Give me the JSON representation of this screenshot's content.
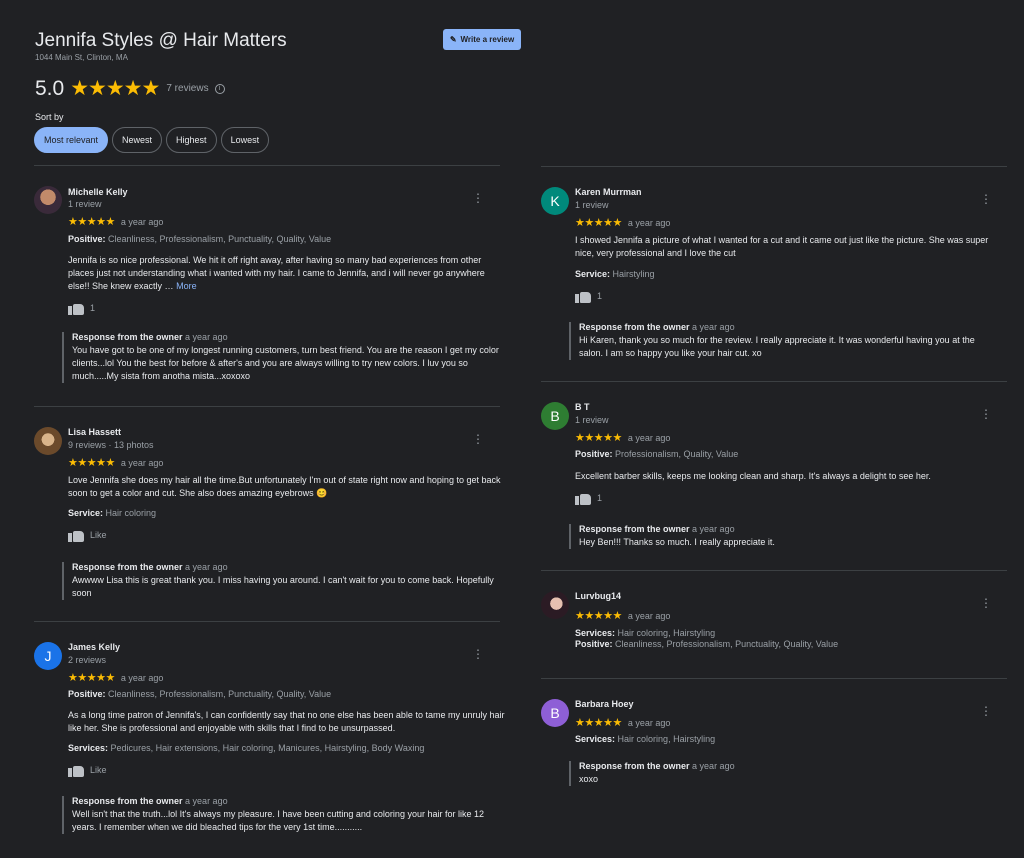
{
  "business": {
    "name": "Jennifa Styles @ Hair Matters",
    "address": "1044 Main St, Clinton, MA",
    "rating": "5.0",
    "review_count": "7 reviews",
    "write_review": "Write a review"
  },
  "sort": {
    "label": "Sort by",
    "options": [
      "Most relevant",
      "Newest",
      "Highest",
      "Lowest"
    ],
    "selected": "Most relevant"
  },
  "stars": "★★★★★",
  "reviews": [
    {
      "name": "Michelle Kelly",
      "sub": "1 review",
      "time": "a year ago",
      "attr1_label": "Positive:",
      "attr1": "Cleanliness, Professionalism, Punctuality, Quality, Value",
      "text": "Jennifa is so nice professional. We hit it off right away,  after having so many bad experiences from other places just not understanding what i wanted with my hair.  I came to Jennifa,  and i will never go anywhere else!! She knew exactly …",
      "more": "More",
      "likes": "1",
      "response_label": "Response from the owner",
      "response_time": "a year ago",
      "response": "You have got to be one of my longest running customers, turn best friend. You are the reason I get my color clients...lol You the best for before & after's and you are always willing to try new colors. I luv you so much.....My sista from anotha mista...xoxoxo"
    },
    {
      "name": "Lisa Hassett",
      "sub": "9 reviews · 13 photos",
      "time": "a year ago",
      "text": "Love Jennifa she does my hair all the time.But unfortunately  I'm out of state right now and hoping to get back soon to get a color and cut. She also does amazing eyebrows 😊",
      "attr1_label": "Service:",
      "attr1": "Hair coloring",
      "likes": "Like",
      "response_label": "Response from the owner",
      "response_time": "a year ago",
      "response": "Awwww Lisa this is great thank you. I miss having you around. I can't wait for you to come back. Hopefully soon"
    },
    {
      "initial": "J",
      "color": "#1a73e8",
      "name": "James Kelly",
      "sub": "2 reviews",
      "time": "a year ago",
      "attr1_label": "Positive:",
      "attr1": "Cleanliness, Professionalism, Punctuality, Quality, Value",
      "text": "As a long time patron of Jennifa's, I can confidently say that no one else has been able to tame my unruly hair like her. She is professional and enjoyable with skills that I find to be unsurpassed.",
      "attr2_label": "Services:",
      "attr2": "Pedicures, Hair extensions, Hair coloring, Manicures, Hairstyling, Body Waxing",
      "likes": "Like",
      "response_label": "Response from the owner",
      "response_time": "a year ago",
      "response": "Well isn't that the truth...lol It's always my pleasure. I have been cutting and coloring your hair for like 12 years. I remember when we did bleached tips for the very 1st time..........."
    },
    {
      "initial": "K",
      "color": "#00897b",
      "name": "Karen Murrman",
      "sub": "1 review",
      "time": "a year ago",
      "text": "I showed Jennifa a picture of what I wanted for a cut and it came out just like the picture. She was super nice, very professional and I love the cut",
      "attr1_label": "Service:",
      "attr1": "Hairstyling",
      "likes": "1",
      "response_label": "Response from the owner",
      "response_time": "a year ago",
      "response": "Hi Karen, thank you so much for the review. I really appreciate it. It was wonderful having you at the salon. I am so happy you like your hair cut. xo"
    },
    {
      "initial": "B",
      "color": "#2e7d32",
      "name": "B T",
      "sub": "1 review",
      "time": "a year ago",
      "attr1_label": "Positive:",
      "attr1": "Professionalism, Quality, Value",
      "text": "Excellent barber skills, keeps me looking clean and sharp. It's always a delight to see her.",
      "likes": "1",
      "response_label": "Response from the owner",
      "response_time": "a year ago",
      "response": "Hey Ben!!! Thanks so much. I really appreciate it."
    },
    {
      "name": "Lurvbug14",
      "time": "a year ago",
      "attr1_label": "Services:",
      "attr1": "Hair coloring, Hairstyling",
      "attr2_label": "Positive:",
      "attr2": "Cleanliness, Professionalism, Punctuality, Quality, Value"
    },
    {
      "initial": "B",
      "color": "#8e5fd6",
      "name": "Barbara Hoey",
      "time": "a year ago",
      "attr1_label": "Services:",
      "attr1": "Hair coloring, Hairstyling",
      "response_label": "Response from the owner",
      "response_time": "a year ago",
      "response": "xoxo"
    }
  ]
}
